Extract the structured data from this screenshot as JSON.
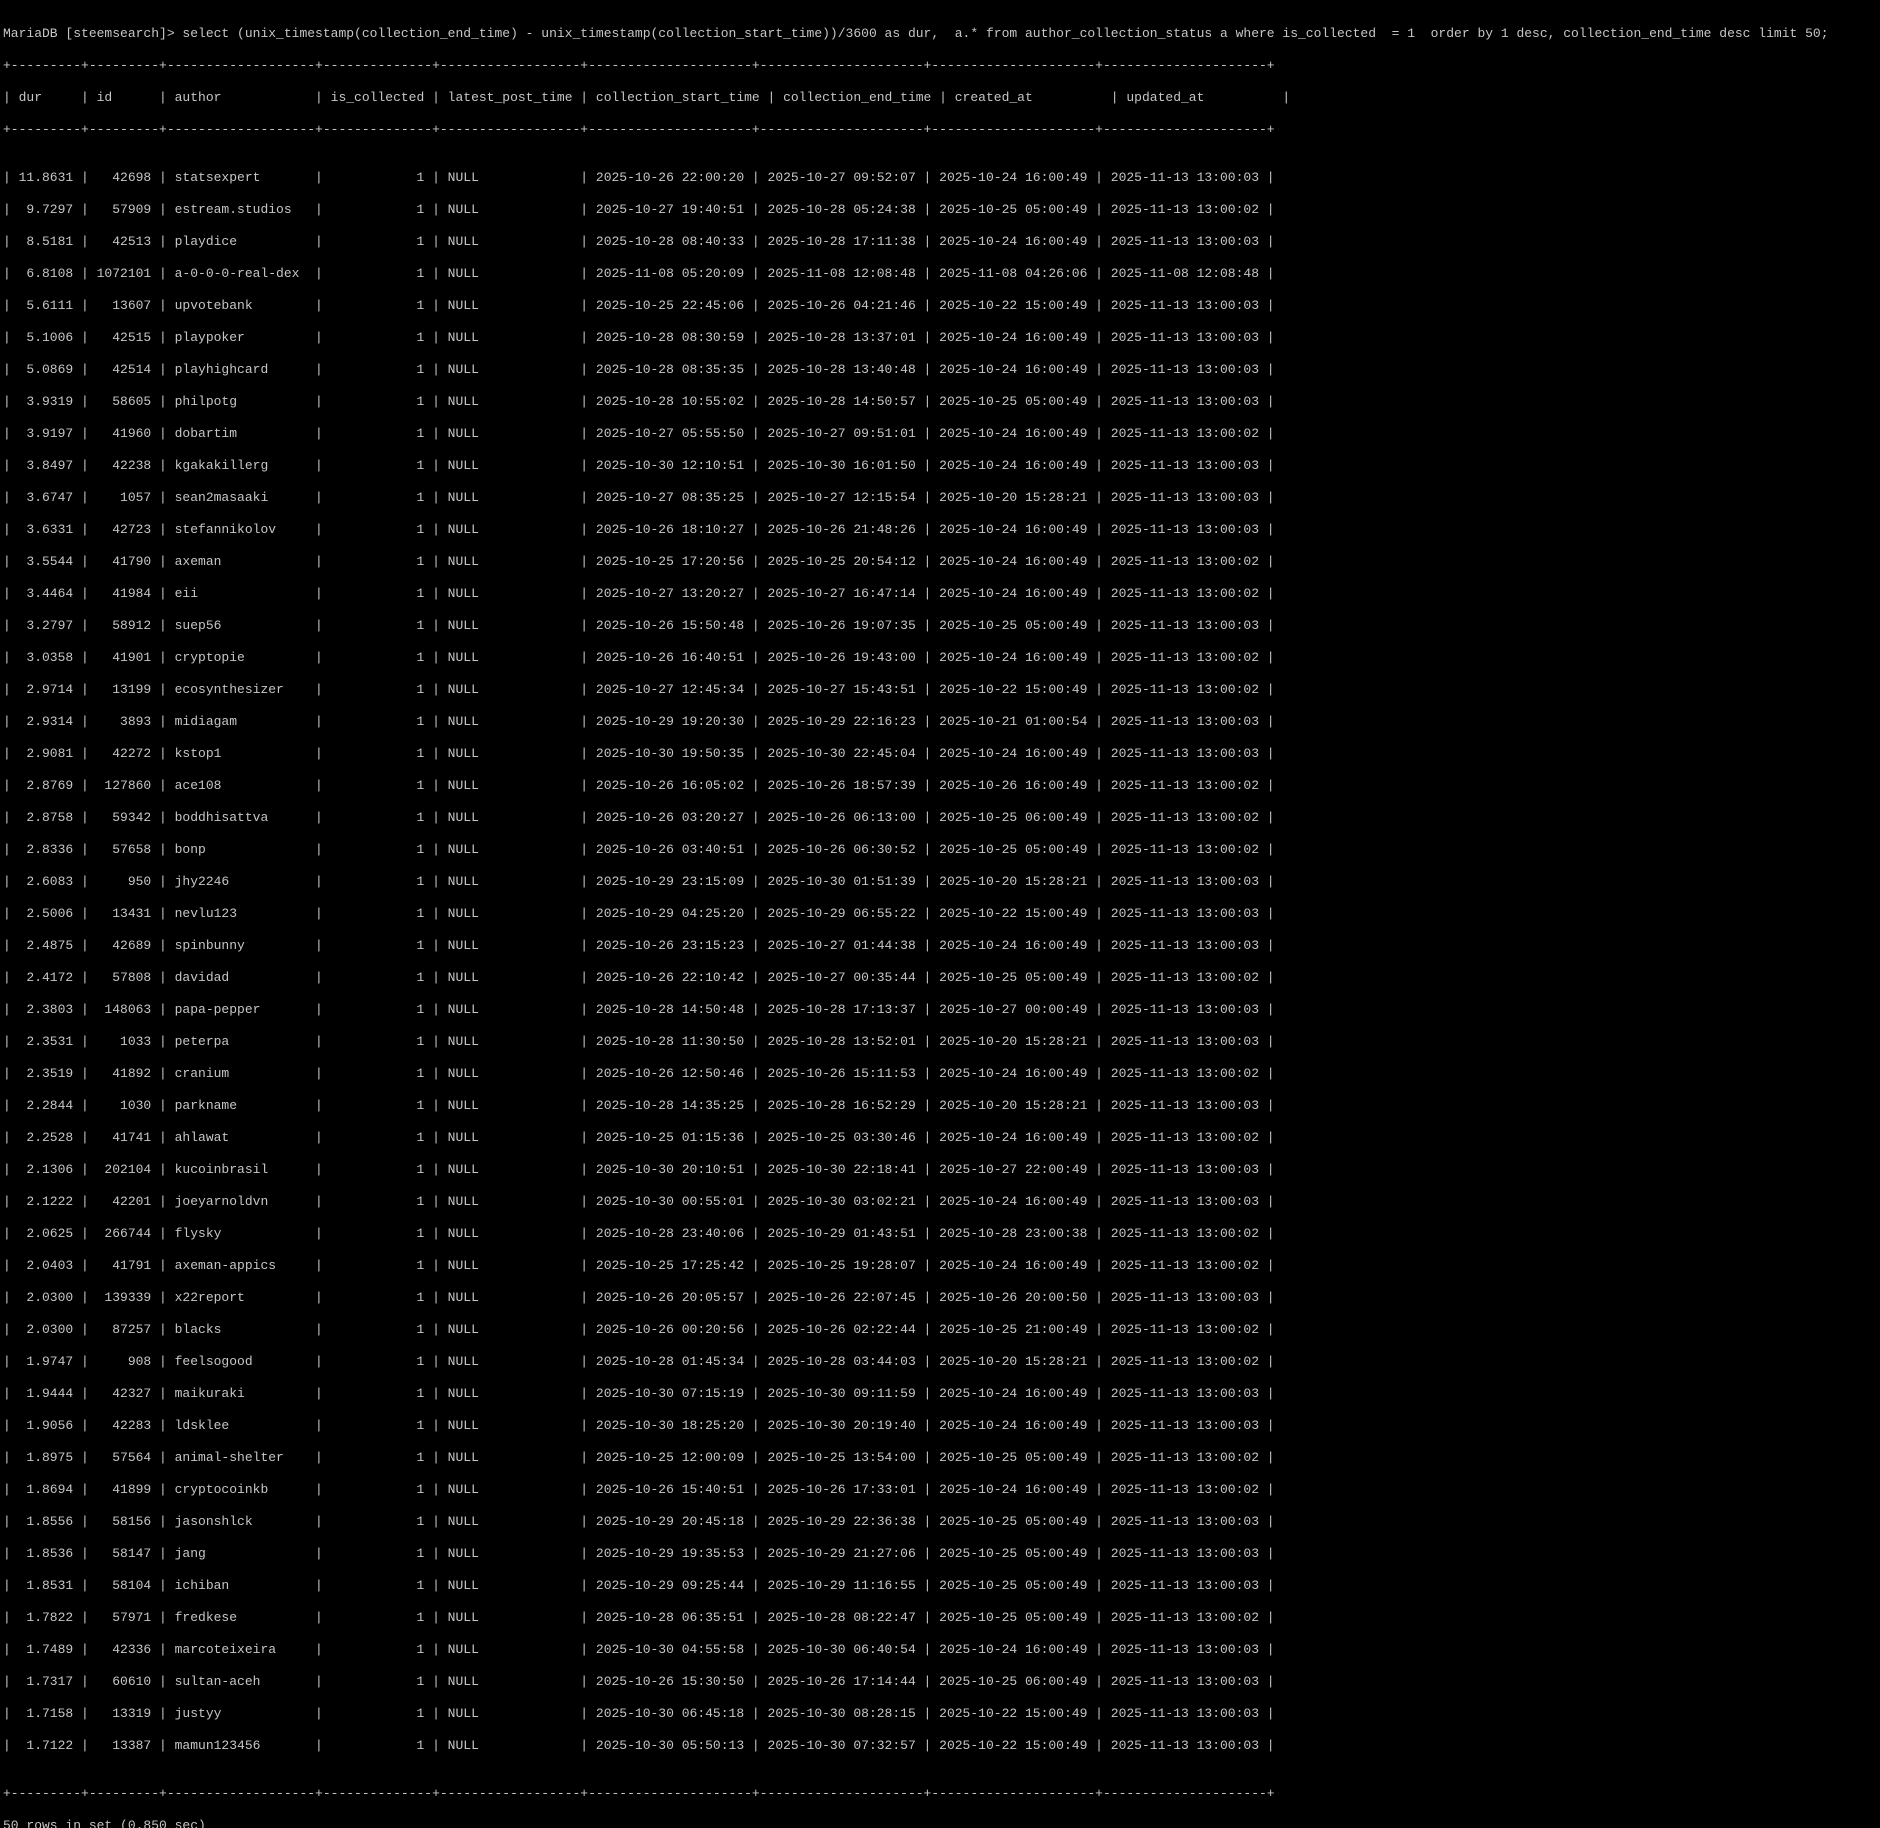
{
  "terminal": {
    "prompt_line": "MariaDB [steemsearch]> select (unix_timestamp(collection_end_time) - unix_timestamp(collection_start_time))/3600 as dur,  a.* from author_collection_status a where is_collected  = 1  order by 1 desc, collection_end_time desc limit 50;",
    "border_line": "+---------+---------+-------------------+--------------+------------------+---------------------+---------------------+---------------------+---------------------+",
    "header_line": "| dur     | id      | author            | is_collected | latest_post_time | collection_start_time | collection_end_time | created_at          | updated_at          |",
    "result_line": "50 rows in set (0.850 sec)",
    "colors": {
      "background": "#000000",
      "foreground": "#c6c6c6"
    }
  },
  "table": {
    "columns": [
      "dur",
      "id",
      "author",
      "is_collected",
      "latest_post_time",
      "collection_start_time",
      "collection_end_time",
      "created_at",
      "updated_at"
    ],
    "rows": [
      "| 11.8631 |   42698 | statsexpert       |            1 | NULL             | 2025-10-26 22:00:20 | 2025-10-27 09:52:07 | 2025-10-24 16:00:49 | 2025-11-13 13:00:03 |",
      "|  9.7297 |   57909 | estream.studios   |            1 | NULL             | 2025-10-27 19:40:51 | 2025-10-28 05:24:38 | 2025-10-25 05:00:49 | 2025-11-13 13:00:02 |",
      "|  8.5181 |   42513 | playdice          |            1 | NULL             | 2025-10-28 08:40:33 | 2025-10-28 17:11:38 | 2025-10-24 16:00:49 | 2025-11-13 13:00:03 |",
      "|  6.8108 | 1072101 | a-0-0-0-real-dex  |            1 | NULL             | 2025-11-08 05:20:09 | 2025-11-08 12:08:48 | 2025-11-08 04:26:06 | 2025-11-08 12:08:48 |",
      "|  5.6111 |   13607 | upvotebank        |            1 | NULL             | 2025-10-25 22:45:06 | 2025-10-26 04:21:46 | 2025-10-22 15:00:49 | 2025-11-13 13:00:03 |",
      "|  5.1006 |   42515 | playpoker         |            1 | NULL             | 2025-10-28 08:30:59 | 2025-10-28 13:37:01 | 2025-10-24 16:00:49 | 2025-11-13 13:00:03 |",
      "|  5.0869 |   42514 | playhighcard      |            1 | NULL             | 2025-10-28 08:35:35 | 2025-10-28 13:40:48 | 2025-10-24 16:00:49 | 2025-11-13 13:00:03 |",
      "|  3.9319 |   58605 | philpotg          |            1 | NULL             | 2025-10-28 10:55:02 | 2025-10-28 14:50:57 | 2025-10-25 05:00:49 | 2025-11-13 13:00:03 |",
      "|  3.9197 |   41960 | dobartim          |            1 | NULL             | 2025-10-27 05:55:50 | 2025-10-27 09:51:01 | 2025-10-24 16:00:49 | 2025-11-13 13:00:02 |",
      "|  3.8497 |   42238 | kgakakillerg      |            1 | NULL             | 2025-10-30 12:10:51 | 2025-10-30 16:01:50 | 2025-10-24 16:00:49 | 2025-11-13 13:00:03 |",
      "|  3.6747 |    1057 | sean2masaaki      |            1 | NULL             | 2025-10-27 08:35:25 | 2025-10-27 12:15:54 | 2025-10-20 15:28:21 | 2025-11-13 13:00:03 |",
      "|  3.6331 |   42723 | stefannikolov     |            1 | NULL             | 2025-10-26 18:10:27 | 2025-10-26 21:48:26 | 2025-10-24 16:00:49 | 2025-11-13 13:00:03 |",
      "|  3.5544 |   41790 | axeman            |            1 | NULL             | 2025-10-25 17:20:56 | 2025-10-25 20:54:12 | 2025-10-24 16:00:49 | 2025-11-13 13:00:02 |",
      "|  3.4464 |   41984 | eii               |            1 | NULL             | 2025-10-27 13:20:27 | 2025-10-27 16:47:14 | 2025-10-24 16:00:49 | 2025-11-13 13:00:02 |",
      "|  3.2797 |   58912 | suep56            |            1 | NULL             | 2025-10-26 15:50:48 | 2025-10-26 19:07:35 | 2025-10-25 05:00:49 | 2025-11-13 13:00:03 |",
      "|  3.0358 |   41901 | cryptopie         |            1 | NULL             | 2025-10-26 16:40:51 | 2025-10-26 19:43:00 | 2025-10-24 16:00:49 | 2025-11-13 13:00:02 |",
      "|  2.9714 |   13199 | ecosynthesizer    |            1 | NULL             | 2025-10-27 12:45:34 | 2025-10-27 15:43:51 | 2025-10-22 15:00:49 | 2025-11-13 13:00:02 |",
      "|  2.9314 |    3893 | midiagam          |            1 | NULL             | 2025-10-29 19:20:30 | 2025-10-29 22:16:23 | 2025-10-21 01:00:54 | 2025-11-13 13:00:03 |",
      "|  2.9081 |   42272 | kstop1            |            1 | NULL             | 2025-10-30 19:50:35 | 2025-10-30 22:45:04 | 2025-10-24 16:00:49 | 2025-11-13 13:00:03 |",
      "|  2.8769 |  127860 | ace108            |            1 | NULL             | 2025-10-26 16:05:02 | 2025-10-26 18:57:39 | 2025-10-26 16:00:49 | 2025-11-13 13:00:02 |",
      "|  2.8758 |   59342 | boddhisattva      |            1 | NULL             | 2025-10-26 03:20:27 | 2025-10-26 06:13:00 | 2025-10-25 06:00:49 | 2025-11-13 13:00:02 |",
      "|  2.8336 |   57658 | bonp              |            1 | NULL             | 2025-10-26 03:40:51 | 2025-10-26 06:30:52 | 2025-10-25 05:00:49 | 2025-11-13 13:00:02 |",
      "|  2.6083 |     950 | jhy2246           |            1 | NULL             | 2025-10-29 23:15:09 | 2025-10-30 01:51:39 | 2025-10-20 15:28:21 | 2025-11-13 13:00:03 |",
      "|  2.5006 |   13431 | nevlu123          |            1 | NULL             | 2025-10-29 04:25:20 | 2025-10-29 06:55:22 | 2025-10-22 15:00:49 | 2025-11-13 13:00:03 |",
      "|  2.4875 |   42689 | spinbunny         |            1 | NULL             | 2025-10-26 23:15:23 | 2025-10-27 01:44:38 | 2025-10-24 16:00:49 | 2025-11-13 13:00:03 |",
      "|  2.4172 |   57808 | davidad           |            1 | NULL             | 2025-10-26 22:10:42 | 2025-10-27 00:35:44 | 2025-10-25 05:00:49 | 2025-11-13 13:00:02 |",
      "|  2.3803 |  148063 | papa-pepper       |            1 | NULL             | 2025-10-28 14:50:48 | 2025-10-28 17:13:37 | 2025-10-27 00:00:49 | 2025-11-13 13:00:03 |",
      "|  2.3531 |    1033 | peterpa           |            1 | NULL             | 2025-10-28 11:30:50 | 2025-10-28 13:52:01 | 2025-10-20 15:28:21 | 2025-11-13 13:00:03 |",
      "|  2.3519 |   41892 | cranium           |            1 | NULL             | 2025-10-26 12:50:46 | 2025-10-26 15:11:53 | 2025-10-24 16:00:49 | 2025-11-13 13:00:02 |",
      "|  2.2844 |    1030 | parkname          |            1 | NULL             | 2025-10-28 14:35:25 | 2025-10-28 16:52:29 | 2025-10-20 15:28:21 | 2025-11-13 13:00:03 |",
      "|  2.2528 |   41741 | ahlawat           |            1 | NULL             | 2025-10-25 01:15:36 | 2025-10-25 03:30:46 | 2025-10-24 16:00:49 | 2025-11-13 13:00:02 |",
      "|  2.1306 |  202104 | kucoinbrasil      |            1 | NULL             | 2025-10-30 20:10:51 | 2025-10-30 22:18:41 | 2025-10-27 22:00:49 | 2025-11-13 13:00:03 |",
      "|  2.1222 |   42201 | joeyarnoldvn      |            1 | NULL             | 2025-10-30 00:55:01 | 2025-10-30 03:02:21 | 2025-10-24 16:00:49 | 2025-11-13 13:00:03 |",
      "|  2.0625 |  266744 | flysky            |            1 | NULL             | 2025-10-28 23:40:06 | 2025-10-29 01:43:51 | 2025-10-28 23:00:38 | 2025-11-13 13:00:02 |",
      "|  2.0403 |   41791 | axeman-appics     |            1 | NULL             | 2025-10-25 17:25:42 | 2025-10-25 19:28:07 | 2025-10-24 16:00:49 | 2025-11-13 13:00:02 |",
      "|  2.0300 |  139339 | x22report         |            1 | NULL             | 2025-10-26 20:05:57 | 2025-10-26 22:07:45 | 2025-10-26 20:00:50 | 2025-11-13 13:00:03 |",
      "|  2.0300 |   87257 | blacks            |            1 | NULL             | 2025-10-26 00:20:56 | 2025-10-26 02:22:44 | 2025-10-25 21:00:49 | 2025-11-13 13:00:02 |",
      "|  1.9747 |     908 | feelsogood        |            1 | NULL             | 2025-10-28 01:45:34 | 2025-10-28 03:44:03 | 2025-10-20 15:28:21 | 2025-11-13 13:00:02 |",
      "|  1.9444 |   42327 | maikuraki         |            1 | NULL             | 2025-10-30 07:15:19 | 2025-10-30 09:11:59 | 2025-10-24 16:00:49 | 2025-11-13 13:00:03 |",
      "|  1.9056 |   42283 | ldsklee           |            1 | NULL             | 2025-10-30 18:25:20 | 2025-10-30 20:19:40 | 2025-10-24 16:00:49 | 2025-11-13 13:00:03 |",
      "|  1.8975 |   57564 | animal-shelter    |            1 | NULL             | 2025-10-25 12:00:09 | 2025-10-25 13:54:00 | 2025-10-25 05:00:49 | 2025-11-13 13:00:02 |",
      "|  1.8694 |   41899 | cryptocoinkb      |            1 | NULL             | 2025-10-26 15:40:51 | 2025-10-26 17:33:01 | 2025-10-24 16:00:49 | 2025-11-13 13:00:02 |",
      "|  1.8556 |   58156 | jasonshlck        |            1 | NULL             | 2025-10-29 20:45:18 | 2025-10-29 22:36:38 | 2025-10-25 05:00:49 | 2025-11-13 13:00:03 |",
      "|  1.8536 |   58147 | jang              |            1 | NULL             | 2025-10-29 19:35:53 | 2025-10-29 21:27:06 | 2025-10-25 05:00:49 | 2025-11-13 13:00:03 |",
      "|  1.8531 |   58104 | ichiban           |            1 | NULL             | 2025-10-29 09:25:44 | 2025-10-29 11:16:55 | 2025-10-25 05:00:49 | 2025-11-13 13:00:03 |",
      "|  1.7822 |   57971 | fredkese          |            1 | NULL             | 2025-10-28 06:35:51 | 2025-10-28 08:22:47 | 2025-10-25 05:00:49 | 2025-11-13 13:00:02 |",
      "|  1.7489 |   42336 | marcoteixeira     |            1 | NULL             | 2025-10-30 04:55:58 | 2025-10-30 06:40:54 | 2025-10-24 16:00:49 | 2025-11-13 13:00:03 |",
      "|  1.7317 |   60610 | sultan-aceh       |            1 | NULL             | 2025-10-26 15:30:50 | 2025-10-26 17:14:44 | 2025-10-25 06:00:49 | 2025-11-13 13:00:03 |",
      "|  1.7158 |   13319 | justyy            |            1 | NULL             | 2025-10-30 06:45:18 | 2025-10-30 08:28:15 | 2025-10-22 15:00:49 | 2025-11-13 13:00:03 |",
      "|  1.7122 |   13387 | mamun123456       |            1 | NULL             | 2025-10-30 05:50:13 | 2025-10-30 07:32:57 | 2025-10-22 15:00:49 | 2025-11-13 13:00:03 |"
    ]
  }
}
